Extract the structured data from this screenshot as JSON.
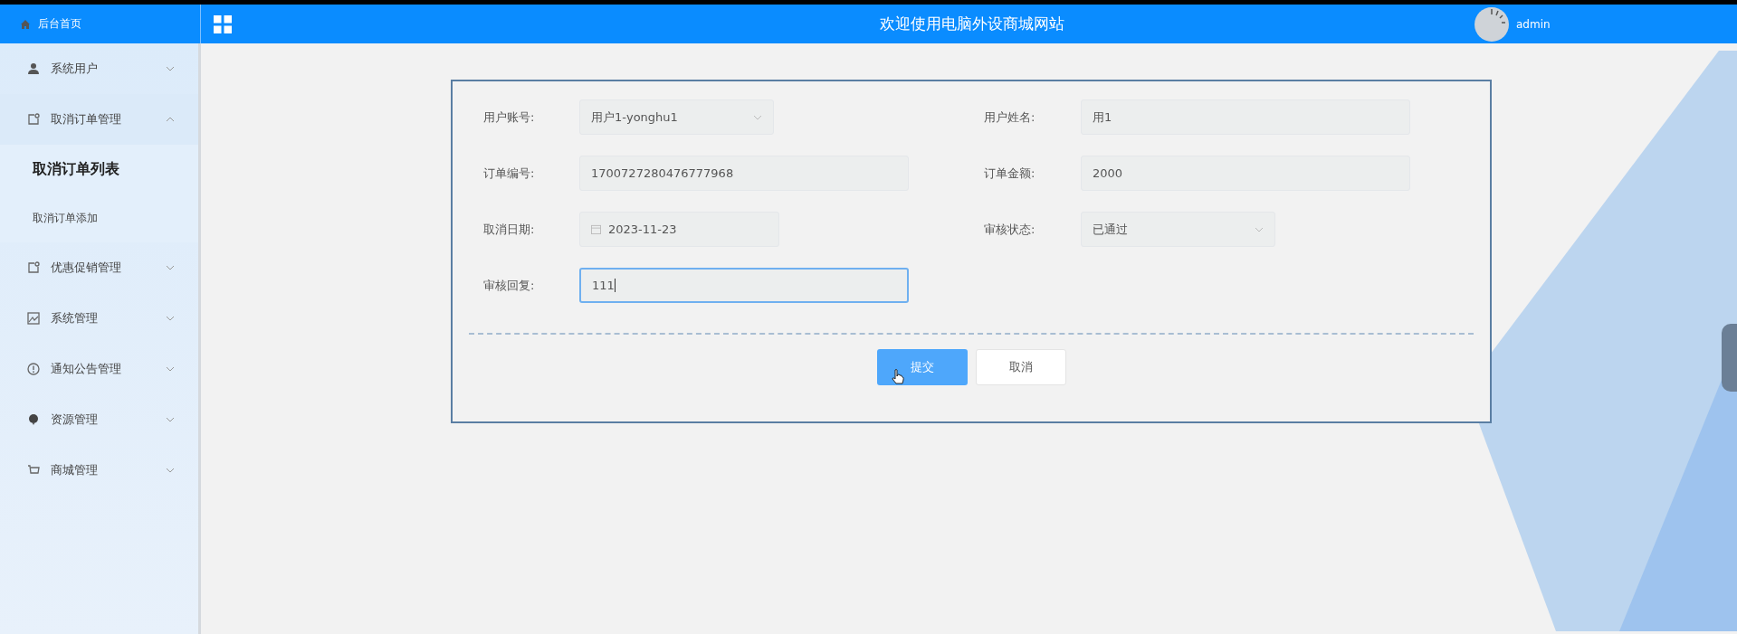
{
  "header": {
    "home_link": "后台首页",
    "title": "欢迎使用电脑外设商城网站",
    "user": "admin"
  },
  "sidebar": {
    "items": [
      {
        "label": "系统用户",
        "expanded": false
      },
      {
        "label": "取消订单管理",
        "expanded": true,
        "children": [
          {
            "label": "取消订单列表",
            "selected": true
          },
          {
            "label": "取消订单添加",
            "selected": false
          }
        ]
      },
      {
        "label": "优惠促销管理",
        "expanded": false
      },
      {
        "label": "系统管理",
        "expanded": false
      },
      {
        "label": "通知公告管理",
        "expanded": false
      },
      {
        "label": "资源管理",
        "expanded": false
      },
      {
        "label": "商城管理",
        "expanded": false
      }
    ]
  },
  "form": {
    "rows": [
      [
        {
          "label": "用户账号:",
          "kind": "select",
          "value": "用户1-yonghu1",
          "focused": false
        },
        {
          "label": "用户姓名:",
          "kind": "text",
          "value": "用1",
          "focused": false
        }
      ],
      [
        {
          "label": "订单编号:",
          "kind": "text",
          "value": "1700727280476777968",
          "focused": false
        },
        {
          "label": "订单金额:",
          "kind": "text",
          "value": "2000",
          "focused": false
        }
      ],
      [
        {
          "label": "取消日期:",
          "kind": "date",
          "value": "2023-11-23",
          "focused": false
        },
        {
          "label": "审核状态:",
          "kind": "select",
          "value": "已通过",
          "focused": false
        }
      ],
      [
        {
          "label": "审核回复:",
          "kind": "text",
          "value": "111",
          "focused": true
        }
      ]
    ],
    "buttons": [
      {
        "label": "提交",
        "kind": "primary"
      },
      {
        "label": "取消",
        "kind": "default"
      }
    ]
  }
}
